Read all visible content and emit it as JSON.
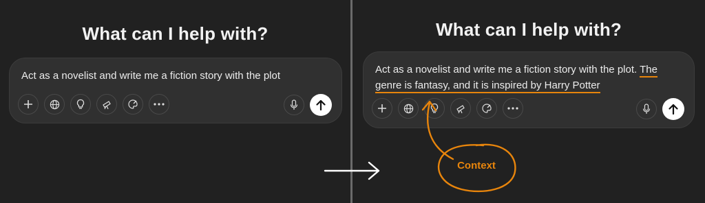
{
  "heading": "What can I help with?",
  "before": {
    "prompt_text": "Act as a novelist and write me a fiction story with the plot"
  },
  "after": {
    "prompt_base": "Act as a novelist and write me a fiction story with the plot.",
    "prompt_line1_added": "The",
    "prompt_line2_added": "genre is fantasy, and it is inspired by Harry Potter"
  },
  "toolbar_icons": [
    "plus-icon",
    "globe-icon",
    "lightbulb-icon",
    "telescope-icon",
    "paint-palette-icon",
    "more-icon"
  ],
  "action_icons": [
    "microphone-icon",
    "send-arrow-up-icon"
  ],
  "annotation": {
    "label": "Context",
    "color": "#e8850c"
  }
}
